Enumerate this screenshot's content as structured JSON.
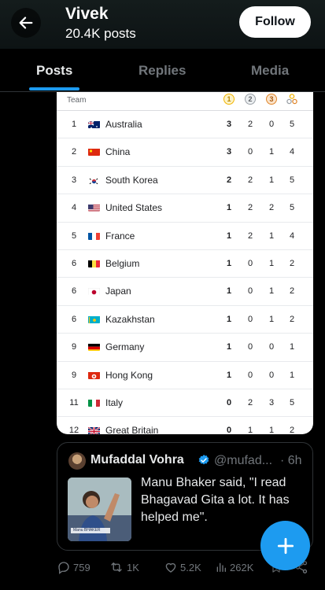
{
  "header": {
    "name": "Vivek",
    "posts_count": "20.4K posts",
    "follow_label": "Follow"
  },
  "tabs": [
    {
      "label": "Posts",
      "active": true
    },
    {
      "label": "Replies",
      "active": false
    },
    {
      "label": "Media",
      "active": false
    }
  ],
  "medal_table": {
    "team_header": "Team",
    "medal_headers": [
      "1",
      "2",
      "3"
    ],
    "rows": [
      {
        "rank": "1",
        "country": "Australia",
        "gold": "3",
        "silver": "2",
        "bronze": "0",
        "total": "5"
      },
      {
        "rank": "2",
        "country": "China",
        "gold": "3",
        "silver": "0",
        "bronze": "1",
        "total": "4"
      },
      {
        "rank": "3",
        "country": "South Korea",
        "gold": "2",
        "silver": "2",
        "bronze": "1",
        "total": "5"
      },
      {
        "rank": "4",
        "country": "United States",
        "gold": "1",
        "silver": "2",
        "bronze": "2",
        "total": "5"
      },
      {
        "rank": "5",
        "country": "France",
        "gold": "1",
        "silver": "2",
        "bronze": "1",
        "total": "4"
      },
      {
        "rank": "6",
        "country": "Belgium",
        "gold": "1",
        "silver": "0",
        "bronze": "1",
        "total": "2"
      },
      {
        "rank": "6",
        "country": "Japan",
        "gold": "1",
        "silver": "0",
        "bronze": "1",
        "total": "2"
      },
      {
        "rank": "6",
        "country": "Kazakhstan",
        "gold": "1",
        "silver": "0",
        "bronze": "1",
        "total": "2"
      },
      {
        "rank": "9",
        "country": "Germany",
        "gold": "1",
        "silver": "0",
        "bronze": "0",
        "total": "1"
      },
      {
        "rank": "9",
        "country": "Hong Kong",
        "gold": "1",
        "silver": "0",
        "bronze": "0",
        "total": "1"
      },
      {
        "rank": "11",
        "country": "Italy",
        "gold": "0",
        "silver": "2",
        "bronze": "3",
        "total": "5"
      },
      {
        "rank": "12",
        "country": "Great Britain",
        "gold": "0",
        "silver": "1",
        "bronze": "1",
        "total": "2"
      }
    ]
  },
  "quote": {
    "author": "Mufaddal Vohra",
    "handle": "@mufad...",
    "time": "· 6h",
    "text": "Manu Bhaker said, \"I read Bhagavad Gita a lot. It has helped me\".",
    "thumb_caption": "Manu BHAKER"
  },
  "actions": {
    "replies": "759",
    "reposts": "1K",
    "likes": "5.2K",
    "views": "262K"
  },
  "colors": {
    "accent": "#1d9bf0",
    "background": "#000000",
    "muted": "#71767b",
    "gold": "#f2b400",
    "silver": "#9aa0a6",
    "bronze": "#e0862a"
  }
}
